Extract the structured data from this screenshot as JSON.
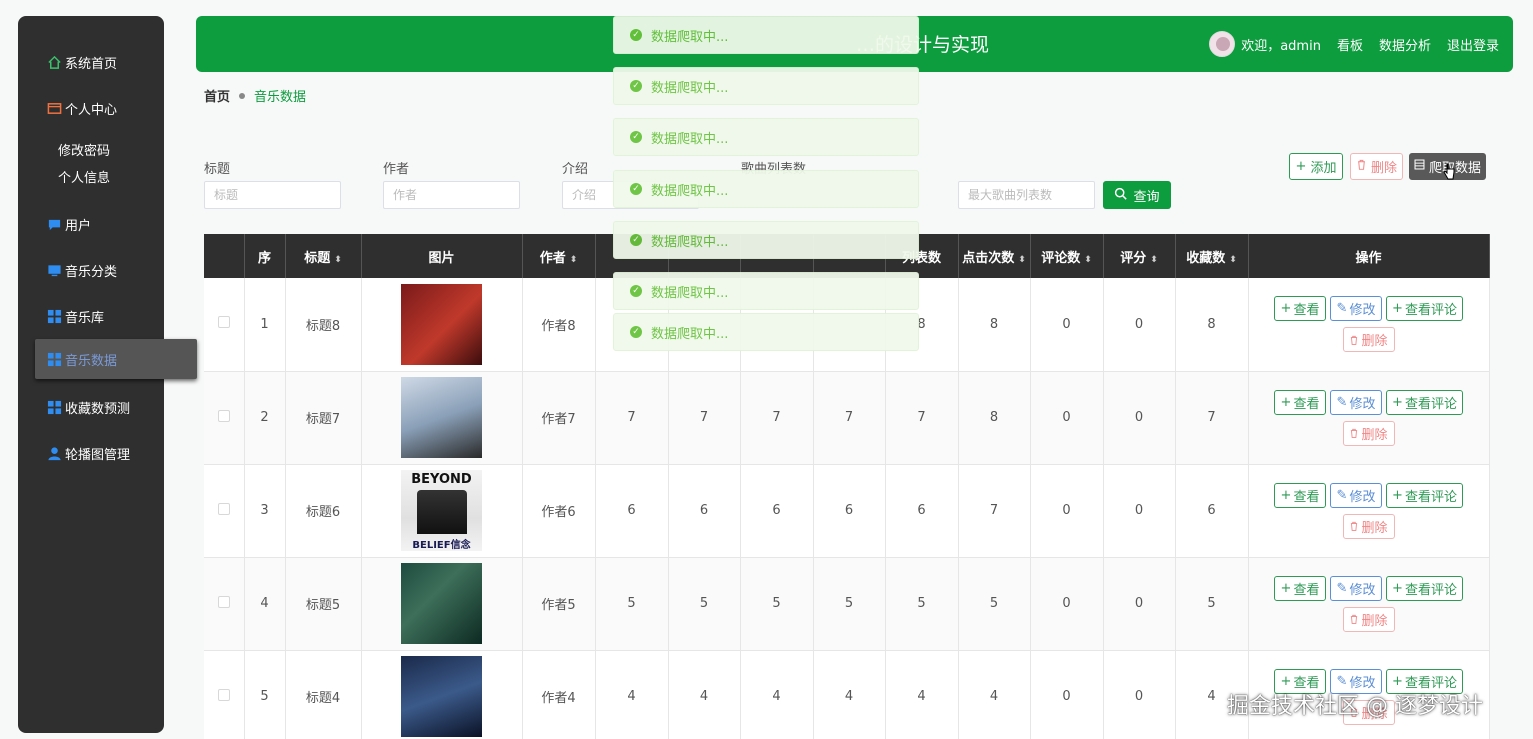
{
  "sidebar": {
    "items": [
      {
        "label": "系统首页",
        "icon": "home-icon"
      },
      {
        "label": "个人中心",
        "icon": "wallet-icon"
      },
      {
        "label": "用户",
        "icon": "chat-icon"
      },
      {
        "label": "音乐分类",
        "icon": "monitor-icon"
      },
      {
        "label": "音乐库",
        "icon": "grid-icon"
      },
      {
        "label": "音乐数据",
        "icon": "grid-icon"
      },
      {
        "label": "收藏数预测",
        "icon": "grid-icon"
      },
      {
        "label": "轮播图管理",
        "icon": "user-icon"
      }
    ],
    "sub_items": [
      {
        "label": "修改密码"
      },
      {
        "label": "个人信息"
      }
    ]
  },
  "header": {
    "title": "…的设计与实现",
    "welcome": "欢迎，admin",
    "links": [
      {
        "label": "看板"
      },
      {
        "label": "数据分析"
      },
      {
        "label": "退出登录"
      }
    ]
  },
  "breadcrumb": {
    "home": "首页",
    "current": "音乐数据"
  },
  "search": {
    "fields": [
      {
        "label": "标题",
        "placeholder": "标题"
      },
      {
        "label": "作者",
        "placeholder": "作者"
      },
      {
        "label": "介绍",
        "placeholder": "介绍"
      },
      {
        "label": "歌曲列表数",
        "placeholder": "最大歌曲列表数"
      }
    ],
    "query_label": "查询"
  },
  "toolbar": {
    "add_label": "添加",
    "delete_label": "删除",
    "crawl_label": "爬取数据"
  },
  "table": {
    "columns": [
      "",
      "序",
      "标题",
      "图片",
      "作者",
      "",
      "",
      "",
      "",
      "列表数",
      "点击次数",
      "评论数",
      "评分",
      "收藏数",
      "操作"
    ],
    "rows": [
      {
        "idx": "1",
        "title": "标题8",
        "author": "作者8",
        "c1": "",
        "c2": "",
        "c3": "",
        "c4": "",
        "list": "8",
        "clicks": "8",
        "comments": "0",
        "score": "0",
        "fav": "8"
      },
      {
        "idx": "2",
        "title": "标题7",
        "author": "作者7",
        "c1": "7",
        "c2": "7",
        "c3": "7",
        "c4": "7",
        "list": "7",
        "clicks": "8",
        "comments": "0",
        "score": "0",
        "fav": "7"
      },
      {
        "idx": "3",
        "title": "标题6",
        "author": "作者6",
        "c1": "6",
        "c2": "6",
        "c3": "6",
        "c4": "6",
        "list": "6",
        "clicks": "7",
        "comments": "0",
        "score": "0",
        "fav": "6"
      },
      {
        "idx": "4",
        "title": "标题5",
        "author": "作者5",
        "c1": "5",
        "c2": "5",
        "c3": "5",
        "c4": "5",
        "list": "5",
        "clicks": "5",
        "comments": "0",
        "score": "0",
        "fav": "5"
      },
      {
        "idx": "5",
        "title": "标题4",
        "author": "作者4",
        "c1": "4",
        "c2": "4",
        "c3": "4",
        "c4": "4",
        "list": "4",
        "clicks": "4",
        "comments": "0",
        "score": "0",
        "fav": "4"
      }
    ],
    "ops": {
      "view": "查看",
      "edit": "修改",
      "comment": "查看评论",
      "delete": "删除"
    }
  },
  "covers": {
    "row3_text": "BEYOND",
    "row3_sub": "BELIEF信念"
  },
  "toasts": [
    {
      "text": "数据爬取中..."
    },
    {
      "text": "数据爬取中..."
    },
    {
      "text": "数据爬取中..."
    },
    {
      "text": "数据爬取中..."
    },
    {
      "text": "数据爬取中..."
    },
    {
      "text": "数据爬取中..."
    },
    {
      "text": "数据爬取中..."
    }
  ],
  "watermark": "掘金技术社区 @ 逐梦设计",
  "colors": {
    "brand": "#0d9c3e",
    "sidebar": "#2f2f2f",
    "success_toast": "#67c23a",
    "danger": "#f08585",
    "edit": "#5b8fd6"
  }
}
